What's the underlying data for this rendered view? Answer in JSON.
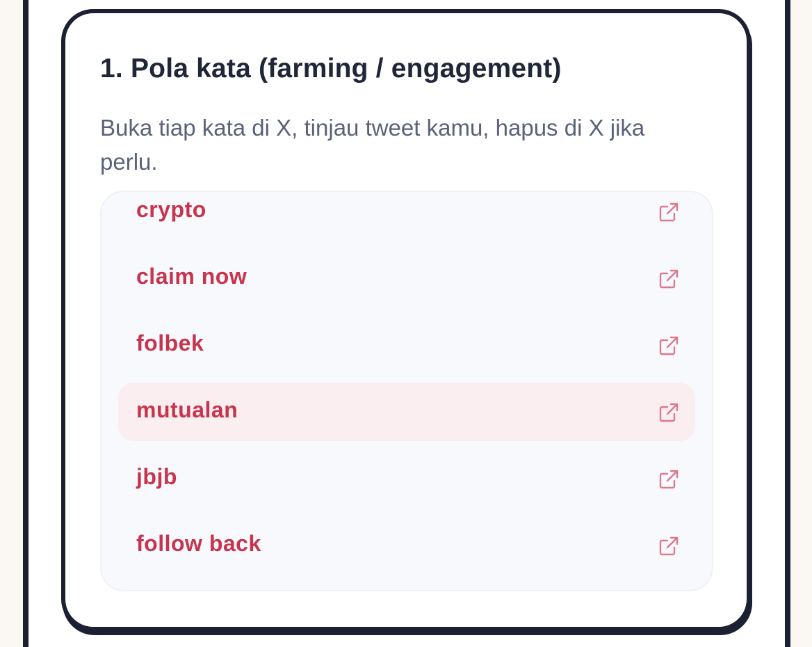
{
  "section": {
    "title": "1. Pola kata (farming / engagement)",
    "description": "Buka tiap kata di X, tinjau tweet kamu, hapus di X jika perlu."
  },
  "keywords": [
    {
      "label": "crypto",
      "icon": "external-link-icon",
      "highlighted": false
    },
    {
      "label": "claim now",
      "icon": "external-link-icon",
      "highlighted": false
    },
    {
      "label": "folbek",
      "icon": "external-link-icon",
      "highlighted": false
    },
    {
      "label": "mutualan",
      "icon": "external-link-icon",
      "highlighted": true
    },
    {
      "label": "jbjb",
      "icon": "external-link-icon",
      "highlighted": false
    },
    {
      "label": "follow back",
      "icon": "external-link-icon",
      "highlighted": false
    }
  ],
  "colors": {
    "keyword_text": "#c8344e",
    "icon_stroke": "#dc7a8c",
    "highlight_bg": "#fbeef0",
    "border": "#1b2133"
  }
}
